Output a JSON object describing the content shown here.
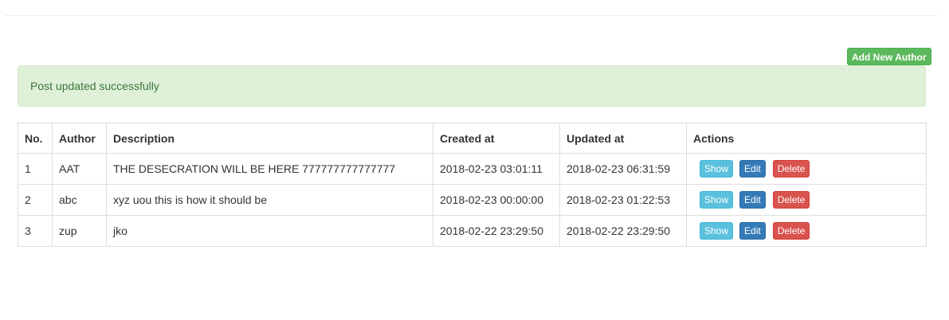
{
  "toolbar": {
    "add_new_author_label": "Add New Author"
  },
  "alert": {
    "message": "Post updated successfully"
  },
  "table": {
    "headers": {
      "no": "No.",
      "author": "Author",
      "description": "Description",
      "created_at": "Created at",
      "updated_at": "Updated at",
      "actions": "Actions"
    },
    "rows": [
      {
        "no": "1",
        "author": "AAT",
        "description": "THE DESECRATION WILL BE HERE 777777777777777",
        "created_at": "2018-02-23 03:01:11",
        "updated_at": "2018-02-23 06:31:59"
      },
      {
        "no": "2",
        "author": "abc",
        "description": "xyz uou this is how it should be",
        "created_at": "2018-02-23 00:00:00",
        "updated_at": "2018-02-23 01:22:53"
      },
      {
        "no": "3",
        "author": "zup",
        "description": "jko",
        "created_at": "2018-02-22 23:29:50",
        "updated_at": "2018-02-22 23:29:50"
      }
    ],
    "action_labels": {
      "show": "Show",
      "edit": "Edit",
      "delete": "Delete"
    }
  },
  "colors": {
    "success": "#5cb85c",
    "info": "#5bc0de",
    "primary": "#337ab7",
    "danger": "#d9534f",
    "alert_bg": "#dff0d8",
    "alert_text": "#3c763d"
  }
}
